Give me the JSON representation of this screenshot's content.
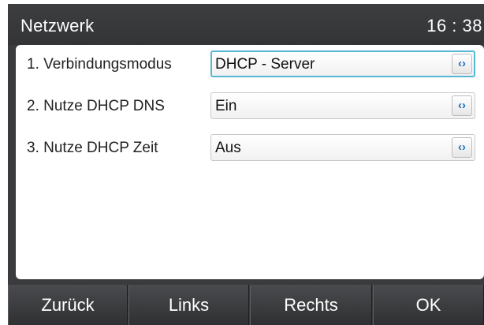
{
  "header": {
    "title": "Netzwerk",
    "time": "16 : 38"
  },
  "settings": [
    {
      "label": "1.  Verbindungsmodus",
      "value": "DHCP - Server",
      "active": true
    },
    {
      "label": "2. Nutze DHCP DNS",
      "value": "Ein",
      "active": false
    },
    {
      "label": "3. Nutze DHCP Zeit",
      "value": "Aus",
      "active": false
    }
  ],
  "selector_glyph": "‹›",
  "softkeys": [
    {
      "label": "Zurück"
    },
    {
      "label": "Links"
    },
    {
      "label": "Rechts"
    },
    {
      "label": "OK"
    }
  ],
  "colors": {
    "frame": "#3a3b3d",
    "focus": "#56b7d3",
    "arrow": "#1e6fb8"
  }
}
